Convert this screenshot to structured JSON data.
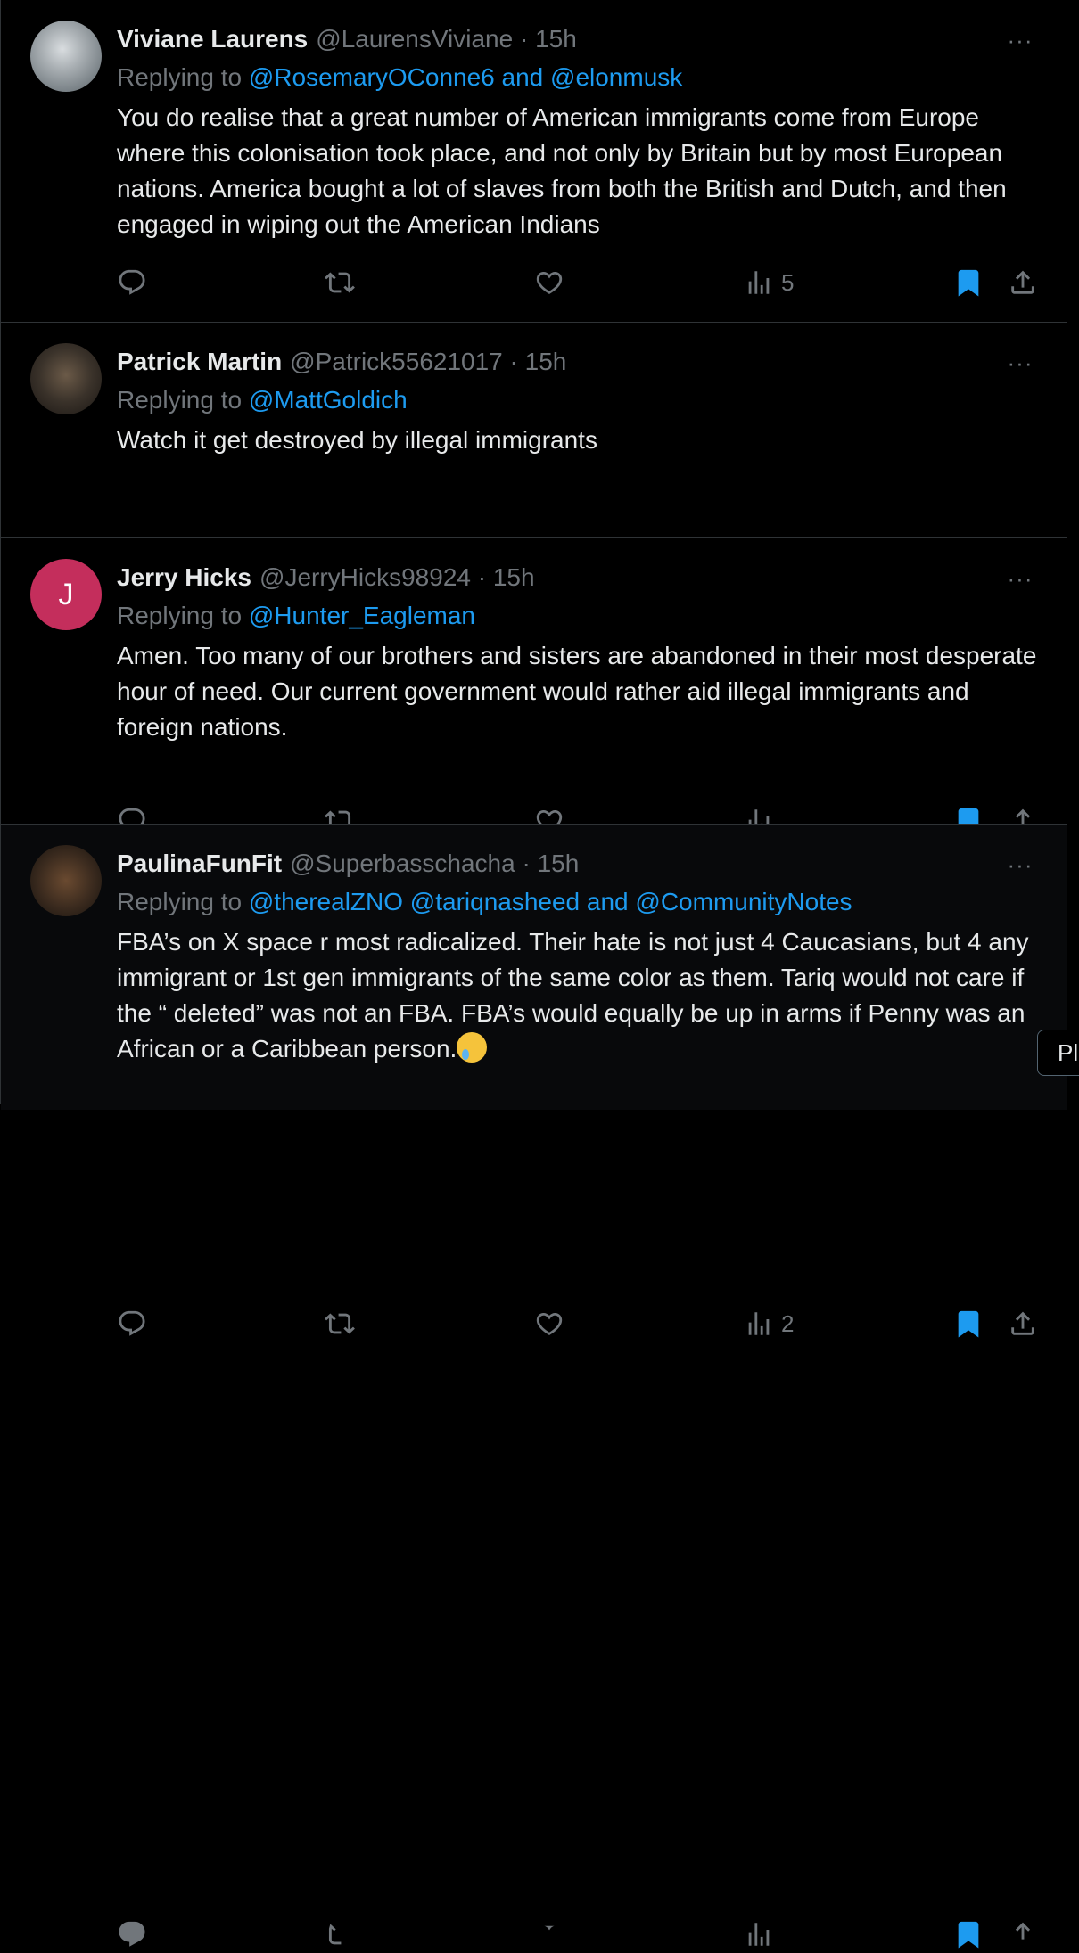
{
  "tweets": [
    {
      "name": "Viviane Laurens",
      "handle": "@LaurensViviane · 15h",
      "replying_prefix": "Replying to ",
      "replying_to": "@RosemaryOConne6 and @elonmusk",
      "text": "You do realise that a great number of American immigrants come from Europe where this colonisation took place, and not only by Britain but by most European nations. America bought a lot of slaves from both the British and Dutch, and then engaged in wiping out the American Indians",
      "views": "5",
      "bookmarked": true
    },
    {
      "name": "Patrick Martin",
      "handle": "@Patrick55621017 · 15h",
      "replying_prefix": "Replying to ",
      "replying_to": "@MattGoldich",
      "text": "Watch it get destroyed by illegal immigrants",
      "views": "",
      "bookmarked": true
    },
    {
      "name": "Jerry Hicks",
      "handle": "@JerryHicks98924 · 15h",
      "avatar_letter": "J",
      "replying_prefix": "Replying to ",
      "replying_to": "@Hunter_Eagleman",
      "text": "Amen. Too many of our brothers and sisters are abandoned in their most desperate hour of need.  Our current government would rather aid illegal immigrants and foreign nations.",
      "views": "2",
      "bookmarked": true
    },
    {
      "name": "PaulinaFunFit",
      "handle": "@Superbasschacha · 15h",
      "replying_prefix": "Replying to ",
      "replying_to": "@therealZNO @tariqnasheed and @CommunityNotes",
      "text": "FBA’s on X space r most radicalized. Their hate is not just 4 Caucasians, but 4 any immigrant or 1st gen immigrants of the same color as them. Tariq would not care if the “ deleted” was not an FBA. FBA’s would equally be up in arms if Penny was an African or a Caribbean person.",
      "views": "",
      "bookmarked": true
    }
  ],
  "more_label": "···",
  "tooltip_text": "Pl",
  "colors": {
    "background": "#000000",
    "accent": "#1d9bf0",
    "muted": "#71767b",
    "text": "#e7e9ea",
    "avatar_j": "#c42e5c"
  },
  "icons": [
    "reply-icon",
    "retweet-icon",
    "like-icon",
    "views-icon",
    "bookmark-icon",
    "share-icon",
    "more-icon",
    "crying-emoji"
  ]
}
